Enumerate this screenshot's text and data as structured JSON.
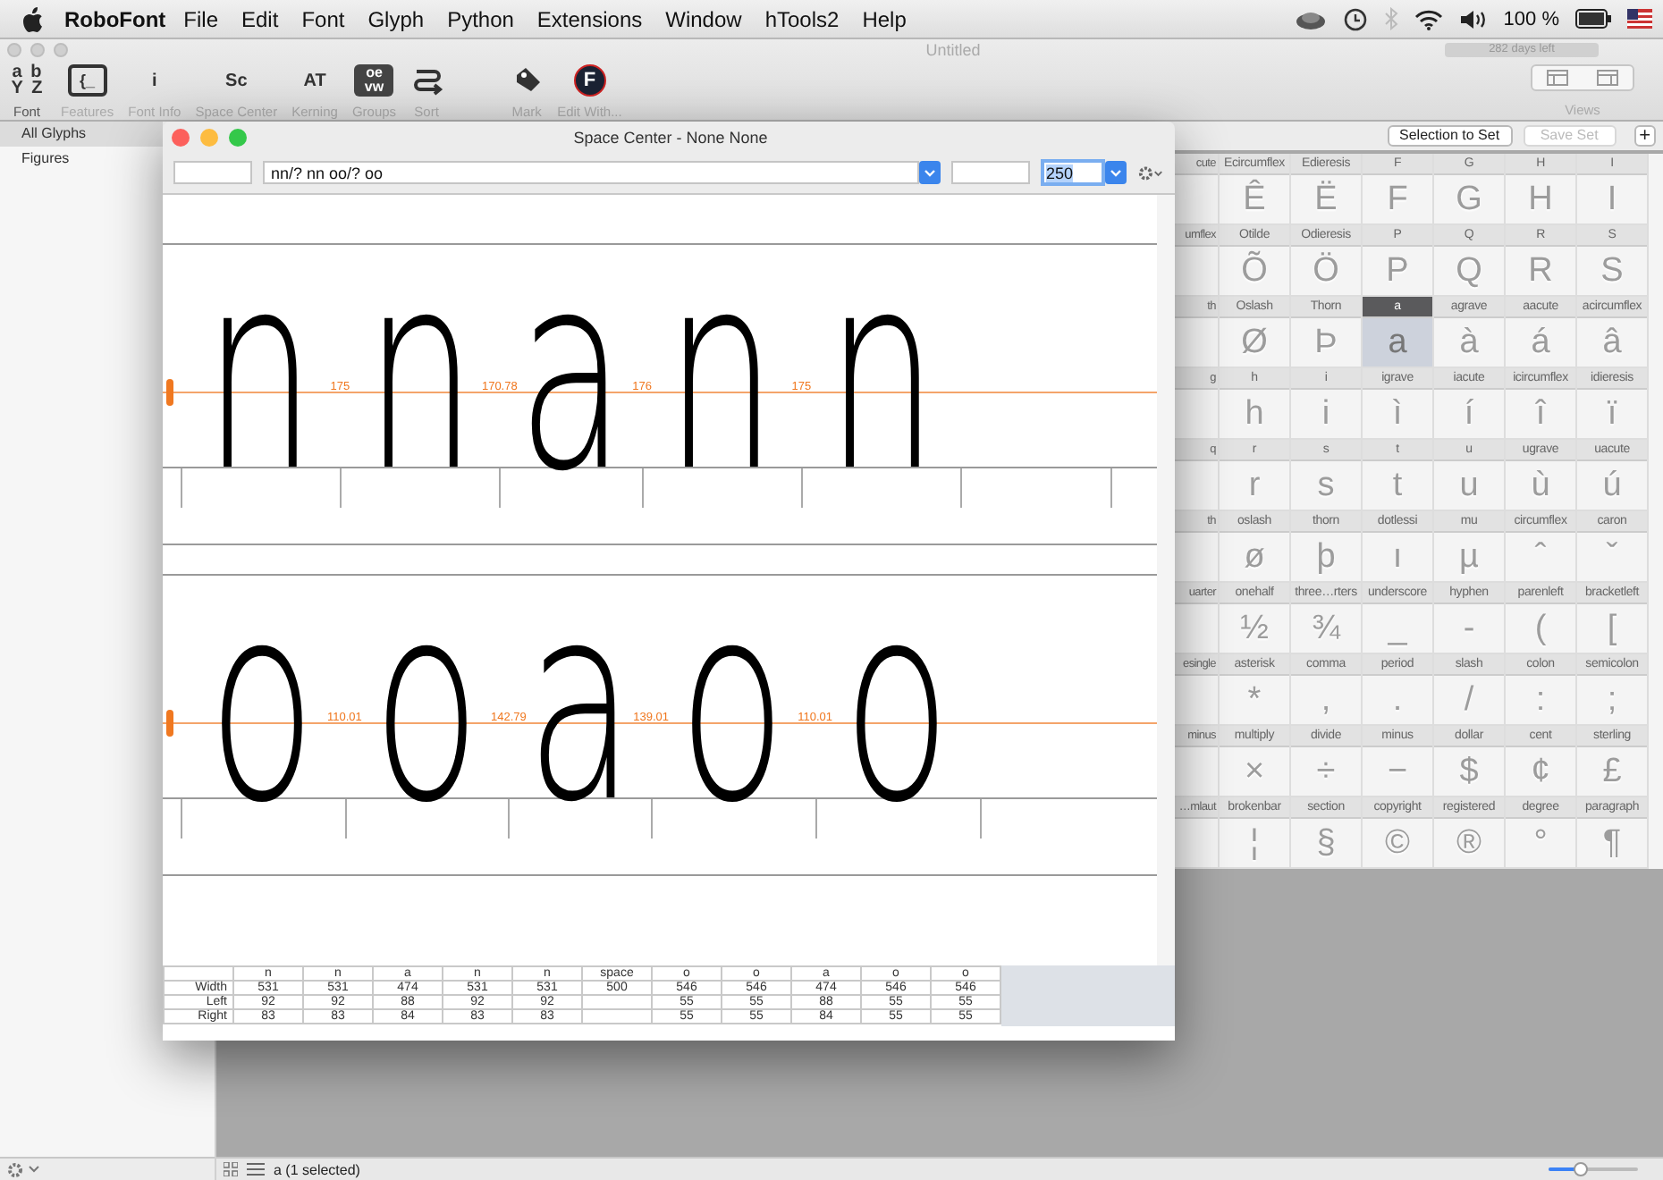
{
  "menu_bar": {
    "app": "RoboFont",
    "items": [
      "File",
      "Edit",
      "Font",
      "Glyph",
      "Python",
      "Extensions",
      "Window",
      "hTools2",
      "Help"
    ],
    "battery": "100 %"
  },
  "font_window": {
    "title": "Untitled",
    "trial_badge": "282 days left",
    "toolbar": [
      {
        "label": "Font",
        "kind": "letters",
        "icon_text": "a b Y Z",
        "selected": true
      },
      {
        "label": "Features",
        "kind": "boxed",
        "icon_text": "{_",
        "selected": false
      },
      {
        "label": "Font Info",
        "kind": "letters",
        "icon_text": "i",
        "selected": false
      },
      {
        "label": "Space Center",
        "kind": "letters",
        "icon_text": "Sc",
        "selected": false
      },
      {
        "label": "Kerning",
        "kind": "letters",
        "icon_text": "AT",
        "selected": false
      },
      {
        "label": "Groups",
        "kind": "dark",
        "icon_text": "oe vw",
        "selected": false
      },
      {
        "label": "Sort",
        "kind": "sort",
        "selected": false
      },
      {
        "label": "Mark",
        "kind": "tag",
        "selected": false
      },
      {
        "label": "Edit With...",
        "kind": "badge",
        "icon_text": "F",
        "selected": false
      }
    ],
    "views_label": "Views",
    "buttons": [
      {
        "label": "Selection to Set",
        "disabled": false
      },
      {
        "label": "Save Set",
        "disabled": true
      },
      {
        "label": "+",
        "disabled": false
      }
    ],
    "sidebar": [
      {
        "label": "All Glyphs",
        "selected": true
      },
      {
        "label": "Figures",
        "selected": false
      }
    ],
    "glyph_rows": [
      [
        {
          "name": "cute",
          "selected": false
        },
        {
          "name": "Ecircumflex",
          "char": "Ê",
          "selected": false
        },
        {
          "name": "Edieresis",
          "char": "Ë",
          "selected": false
        },
        {
          "name": "F",
          "char": "F",
          "selected": false
        },
        {
          "name": "G",
          "char": "G",
          "selected": false
        },
        {
          "name": "H",
          "char": "H",
          "selected": false
        },
        {
          "name": "I",
          "char": "I",
          "selected": false
        }
      ],
      [
        {
          "name": "umflex",
          "selected": false
        },
        {
          "name": "Otilde",
          "char": "Õ",
          "selected": false
        },
        {
          "name": "Odieresis",
          "char": "Ö",
          "selected": false
        },
        {
          "name": "P",
          "char": "P",
          "selected": false
        },
        {
          "name": "Q",
          "char": "Q",
          "selected": false
        },
        {
          "name": "R",
          "char": "R",
          "selected": false
        },
        {
          "name": "S",
          "char": "S",
          "selected": false
        }
      ],
      [
        {
          "name": "th",
          "selected": false
        },
        {
          "name": "Oslash",
          "char": "Ø",
          "selected": false
        },
        {
          "name": "Thorn",
          "char": "Þ",
          "selected": false
        },
        {
          "name": "a",
          "char": "a",
          "selected": true
        },
        {
          "name": "agrave",
          "char": "à",
          "selected": false
        },
        {
          "name": "aacute",
          "char": "á",
          "selected": false
        },
        {
          "name": "acircumflex",
          "char": "â",
          "selected": false
        }
      ],
      [
        {
          "name": "g",
          "selected": false
        },
        {
          "name": "h",
          "char": "h",
          "selected": false
        },
        {
          "name": "i",
          "char": "i",
          "selected": false
        },
        {
          "name": "igrave",
          "char": "ì",
          "selected": false
        },
        {
          "name": "iacute",
          "char": "í",
          "selected": false
        },
        {
          "name": "icircumflex",
          "char": "î",
          "selected": false
        },
        {
          "name": "idieresis",
          "char": "ï",
          "selected": false
        }
      ],
      [
        {
          "name": "q",
          "selected": false
        },
        {
          "name": "r",
          "char": "r",
          "selected": false
        },
        {
          "name": "s",
          "char": "s",
          "selected": false
        },
        {
          "name": "t",
          "char": "t",
          "selected": false
        },
        {
          "name": "u",
          "char": "u",
          "selected": false
        },
        {
          "name": "ugrave",
          "char": "ù",
          "selected": false
        },
        {
          "name": "uacute",
          "char": "ú",
          "selected": false
        }
      ],
      [
        {
          "name": "th",
          "selected": false
        },
        {
          "name": "oslash",
          "char": "ø",
          "selected": false
        },
        {
          "name": "thorn",
          "char": "þ",
          "selected": false
        },
        {
          "name": "dotlessi",
          "char": "ı",
          "selected": false
        },
        {
          "name": "mu",
          "char": "µ",
          "selected": false
        },
        {
          "name": "circumflex",
          "char": "ˆ",
          "selected": false
        },
        {
          "name": "caron",
          "char": "ˇ",
          "selected": false
        }
      ],
      [
        {
          "name": "uarter",
          "selected": false
        },
        {
          "name": "onehalf",
          "char": "½",
          "selected": false
        },
        {
          "name": "three…rters",
          "char": "¾",
          "selected": false
        },
        {
          "name": "underscore",
          "char": "_",
          "selected": false
        },
        {
          "name": "hyphen",
          "char": "-",
          "selected": false
        },
        {
          "name": "parenleft",
          "char": "(",
          "selected": false
        },
        {
          "name": "bracketleft",
          "char": "[",
          "selected": false
        }
      ],
      [
        {
          "name": "esingle",
          "selected": false
        },
        {
          "name": "asterisk",
          "char": "*",
          "selected": false
        },
        {
          "name": "comma",
          "char": ",",
          "selected": false
        },
        {
          "name": "period",
          "char": ".",
          "selected": false
        },
        {
          "name": "slash",
          "char": "/",
          "selected": false
        },
        {
          "name": "colon",
          "char": ":",
          "selected": false
        },
        {
          "name": "semicolon",
          "char": ";",
          "selected": false
        }
      ],
      [
        {
          "name": "minus",
          "selected": false
        },
        {
          "name": "multiply",
          "char": "×",
          "selected": false
        },
        {
          "name": "divide",
          "char": "÷",
          "selected": false
        },
        {
          "name": "minus",
          "char": "−",
          "selected": false
        },
        {
          "name": "dollar",
          "char": "$",
          "selected": false
        },
        {
          "name": "cent",
          "char": "¢",
          "selected": false
        },
        {
          "name": "sterling",
          "char": "£",
          "selected": false
        }
      ],
      [
        {
          "name": "…mlaut",
          "selected": false
        },
        {
          "name": "brokenbar",
          "char": "¦",
          "selected": false
        },
        {
          "name": "section",
          "char": "§",
          "selected": false
        },
        {
          "name": "copyright",
          "char": "©",
          "selected": false
        },
        {
          "name": "registered",
          "char": "®",
          "selected": false
        },
        {
          "name": "degree",
          "char": "°",
          "selected": false
        },
        {
          "name": "paragraph",
          "char": "¶",
          "selected": false
        }
      ]
    ],
    "status": "a (1 selected)",
    "zoom_slider": {
      "level": 0.35
    }
  },
  "space_center": {
    "title": "Space Center - None None",
    "text": "nn/? nn oo/? oo",
    "size": "250",
    "size_selected": true,
    "lines": [
      {
        "glyphs": [
          "n",
          "n",
          "a",
          "n",
          "n"
        ],
        "margins": [
          "175",
          "170.78",
          "176",
          "175"
        ]
      },
      {
        "glyphs": [
          "o",
          "o",
          "a",
          "o",
          "o"
        ],
        "margins": [
          "110.01",
          "142.79",
          "139.01",
          "110.01"
        ]
      }
    ],
    "table": {
      "header": [
        "n",
        "n",
        "a",
        "n",
        "n",
        "space",
        "o",
        "o",
        "a",
        "o",
        "o"
      ],
      "rows": [
        {
          "label": "Width",
          "cells": [
            "531",
            "531",
            "474",
            "531",
            "531",
            "500",
            "546",
            "546",
            "474",
            "546",
            "546"
          ]
        },
        {
          "label": "Left",
          "cells": [
            "92",
            "92",
            "88",
            "92",
            "92",
            null,
            "55",
            "55",
            "88",
            "55",
            "55"
          ]
        },
        {
          "label": "Right",
          "cells": [
            "83",
            "83",
            "84",
            "83",
            "83",
            null,
            "55",
            "55",
            "84",
            "55",
            "55"
          ]
        }
      ]
    }
  }
}
